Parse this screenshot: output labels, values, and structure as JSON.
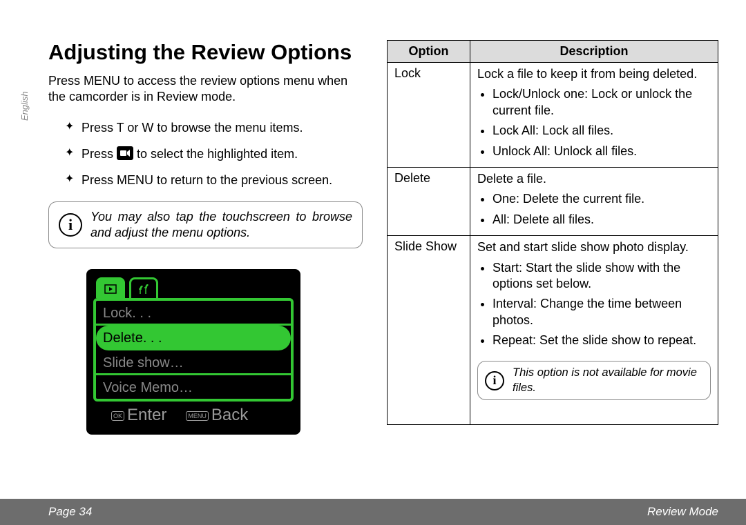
{
  "sidebar_lang": "English",
  "heading": "Adjusting the Review Options",
  "intro": "Press MENU to access the review options menu when the camcorder is in Review mode.",
  "bullets": {
    "b1": "Press T or W to browse the menu items.",
    "b2_pre": "Press ",
    "b2_post": " to select the highlighted item.",
    "b3": "Press MENU to return to the previous screen."
  },
  "tip_main": "You may also tap the touchscreen to browse and adjust the menu options.",
  "screenshot_menu": {
    "m0": "Lock. . .",
    "m1": "Delete. . .",
    "m2": "Slide show…",
    "m3": "Voice Memo…",
    "ok_label": "OK",
    "enter": "Enter",
    "menu_label": "MENU",
    "back": "Back"
  },
  "table": {
    "h_option": "Option",
    "h_desc": "Description",
    "r0": {
      "opt": "Lock",
      "lead": "Lock a file to keep it from being deleted.",
      "l0": "Lock/Unlock one: Lock or unlock the current file.",
      "l1": "Lock All: Lock all files.",
      "l2": "Unlock All: Unlock all files."
    },
    "r1": {
      "opt": "Delete",
      "lead": "Delete a file.",
      "l0": "One: Delete the current file.",
      "l1": "All: Delete all files."
    },
    "r2": {
      "opt": "Slide Show",
      "lead": "Set and start slide show photo display.",
      "l0": "Start: Start the slide show with the options set below.",
      "l1": "Interval: Change the time between photos.",
      "l2": "Repeat: Set the slide show to repeat.",
      "note": "This option is not available for movie files."
    }
  },
  "footer": {
    "left": "Page 34",
    "right": "Review Mode"
  }
}
